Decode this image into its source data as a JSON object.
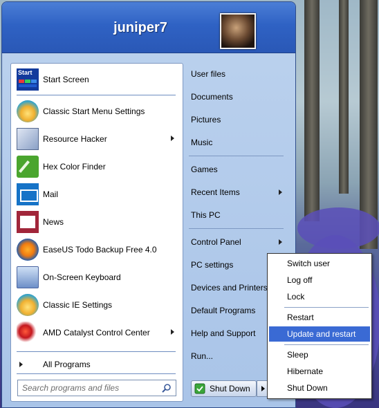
{
  "user": {
    "name": "juniper7"
  },
  "left_items": [
    {
      "label": "Start Screen",
      "icon": "start-screen-icon",
      "arrow": false
    },
    {
      "label": "Classic Start Menu Settings",
      "icon": "shell-icon",
      "arrow": false
    },
    {
      "label": "Resource Hacker",
      "icon": "resource-hacker-icon",
      "arrow": true
    },
    {
      "label": "Hex Color Finder",
      "icon": "hex-color-icon",
      "arrow": false
    },
    {
      "label": "Mail",
      "icon": "mail-icon",
      "arrow": false
    },
    {
      "label": "News",
      "icon": "news-icon",
      "arrow": false
    },
    {
      "label": "EaseUS Todo Backup Free 4.0",
      "icon": "easeus-icon",
      "arrow": false
    },
    {
      "label": "On-Screen Keyboard",
      "icon": "keyboard-icon",
      "arrow": false
    },
    {
      "label": "Classic IE Settings",
      "icon": "shell-icon",
      "arrow": false
    },
    {
      "label": "AMD Catalyst Control Center",
      "icon": "amd-icon",
      "arrow": true
    }
  ],
  "start_screen_icon_text": "Start",
  "all_programs": {
    "label": "All Programs"
  },
  "search": {
    "placeholder": "Search programs and files"
  },
  "right_items": [
    {
      "label": "User files",
      "arrow": false
    },
    {
      "label": "Documents",
      "arrow": false
    },
    {
      "label": "Pictures",
      "arrow": false
    },
    {
      "label": "Music",
      "arrow": false
    },
    {
      "label": "Games",
      "arrow": false
    },
    {
      "label": "Recent Items",
      "arrow": true
    },
    {
      "label": "This PC",
      "arrow": false
    },
    {
      "label": "Control Panel",
      "arrow": true
    },
    {
      "label": "PC settings",
      "arrow": false
    },
    {
      "label": "Devices and Printers",
      "arrow": false
    },
    {
      "label": "Default Programs",
      "arrow": false
    },
    {
      "label": "Help and Support",
      "arrow": false
    },
    {
      "label": "Run...",
      "arrow": false
    }
  ],
  "shutdown": {
    "label": "Shut Down"
  },
  "power_menu": [
    {
      "label": "Switch user",
      "active": false
    },
    {
      "label": "Log off",
      "active": false
    },
    {
      "label": "Lock",
      "active": false
    },
    {
      "label": "Restart",
      "active": false
    },
    {
      "label": "Update and restart",
      "active": true
    },
    {
      "label": "Sleep",
      "active": false
    },
    {
      "label": "Hibernate",
      "active": false
    },
    {
      "label": "Shut Down",
      "active": false
    }
  ],
  "colors": {
    "header": "#2f62c4",
    "highlight": "#3a6ad4",
    "menu_bg": "#a9c4e8"
  }
}
